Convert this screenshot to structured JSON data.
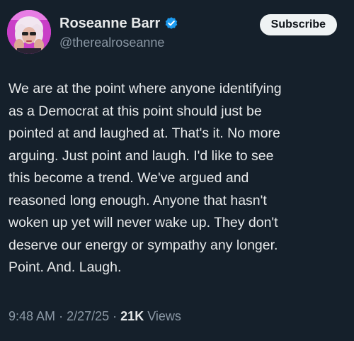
{
  "post": {
    "author": {
      "display_name": "Roseanne Barr",
      "handle": "@therealroseanne",
      "verified_icon": "verified-badge-icon",
      "avatar": "avatar-image"
    },
    "subscribe_label": "Subscribe",
    "text": "We are at the point where anyone identifying\nas a Democrat at this point should just be\npointed at and laughed at. That's it. No more\narguing. Just point and laugh. I'd like to see\nthis become a trend. We've argued and\nreasoned long enough. Anyone that hasn't\nwoken up yet will never wake up. They don't\ndeserve our energy or sympathy any longer.\nPoint. And. Laugh.",
    "time": "9:48 AM",
    "date": "2/27/25",
    "separator": "·",
    "views_count": "21K",
    "views_label": "Views"
  },
  "colors": {
    "background": "#15202b",
    "text": "#e7e9ea",
    "secondary_text": "#8b98a5",
    "verified_blue": "#1d9bf0",
    "button_bg": "#eff3f4"
  }
}
